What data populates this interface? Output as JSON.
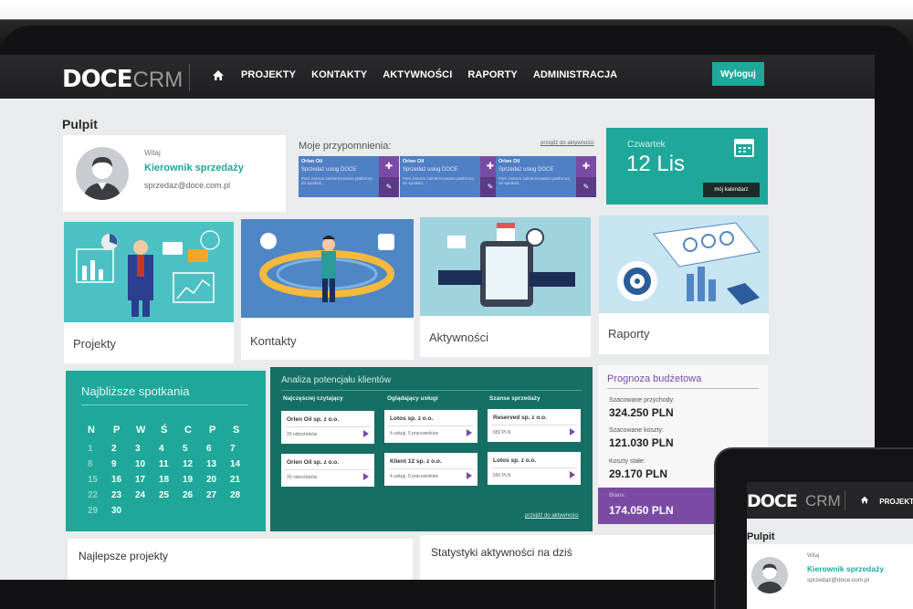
{
  "brand": {
    "bold": "DOCE",
    "light": "CRM"
  },
  "nav": {
    "items": [
      "PROJEKTY",
      "KONTAKTY",
      "AKTYWNOŚCI",
      "RAPORTY",
      "ADMINISTRACJA"
    ],
    "home_icon": "home-icon"
  },
  "logout_label": "Wyloguj",
  "page_title": "Pulpit",
  "welcome": {
    "greeting": "Witaj",
    "role": "Kierownik sprzedaży",
    "email": "sprzedaz@doce.com.pl"
  },
  "reminders": {
    "title": "Moje przypomnienia:",
    "link": "przejdź do aktywności",
    "cards": [
      {
        "company": "Orlen Oil",
        "subject": "Sprzedaż usług DOCE",
        "desc": "Pani Joanna zainteresowana platformą do spotkań..."
      },
      {
        "company": "Orlen Oil",
        "subject": "Sprzedaż usług DOCE",
        "desc": "Pani Joanna zainteresowana platformą do spotkań..."
      },
      {
        "company": "Orlen Oil",
        "subject": "Sprzedaż usług DOCE",
        "desc": "Pani Joanna zainteresowana platformą do spotkań..."
      }
    ]
  },
  "date": {
    "day": "Czwartek",
    "date": "12 Lis",
    "button": "mój kalendarz"
  },
  "modules": [
    {
      "label": "Projekty"
    },
    {
      "label": "Kontakty"
    },
    {
      "label": "Aktywności"
    },
    {
      "label": "Raporty"
    }
  ],
  "meetings": {
    "title": "Najbliższe spotkania",
    "weekdays": [
      "N",
      "P",
      "W",
      "Ś",
      "C",
      "P",
      "S"
    ],
    "rows": [
      [
        "1",
        "2",
        "3",
        "4",
        "5",
        "6",
        "7"
      ],
      [
        "8",
        "9",
        "10",
        "11",
        "12",
        "13",
        "14"
      ],
      [
        "15",
        "16",
        "17",
        "18",
        "19",
        "20",
        "21"
      ],
      [
        "22",
        "23",
        "24",
        "25",
        "26",
        "27",
        "28"
      ],
      [
        "29",
        "30"
      ]
    ]
  },
  "analysis": {
    "title": "Analiza potencjału klientów",
    "columns": [
      {
        "header": "Najczęściej czytający",
        "cards": [
          {
            "name": "Orlen Oil sp. z o.o.",
            "meta": "20 odnośników"
          },
          {
            "name": "Orlen Oil sp. z o.o.",
            "meta": "20 odnośników"
          }
        ]
      },
      {
        "header": "Oglądający usługi",
        "cards": [
          {
            "name": "Lotos sp. z o.o.",
            "meta": "4 usługi, 5 pracowników"
          },
          {
            "name": "Klient 12 sp. z o.o.",
            "meta": "4 usługi, 5 pracowników"
          }
        ]
      },
      {
        "header": "Szanse sprzedaży",
        "cards": [
          {
            "name": "Reserved sp. z o.o.",
            "meta": "650 PLN"
          },
          {
            "name": "Lotos sp. z o.o.",
            "meta": "650 PLN"
          }
        ]
      }
    ],
    "link": "przejdź do aktywności"
  },
  "budget": {
    "title": "Prognoza budżetowa",
    "items": [
      {
        "label": "Szacowane przychody:",
        "value": "324.250 PLN"
      },
      {
        "label": "Szacowane koszty:",
        "value": "121.030 PLN"
      },
      {
        "label": "Koszty stałe:",
        "value": "29.170 PLN"
      }
    ],
    "balance_label": "Bilans:",
    "balance_value": "174.050 PLN"
  },
  "bottom": {
    "left_title": "Najlepsze projekty",
    "right_title": "Statystyki aktywności na dziś"
  },
  "tablet": {
    "brand_bold": "DOCE",
    "brand_light": "CRM",
    "nav_first": "PROJEKTY",
    "page_title": "Pulpit",
    "greeting": "Witaj",
    "role": "Kierownik sprzedaży",
    "email": "sprzedaz@doce.com.pl"
  },
  "colors": {
    "teal": "#1fa79a",
    "dark_teal": "#166f64",
    "purple": "#7a4ba5",
    "blue": "#4f7fc4"
  }
}
